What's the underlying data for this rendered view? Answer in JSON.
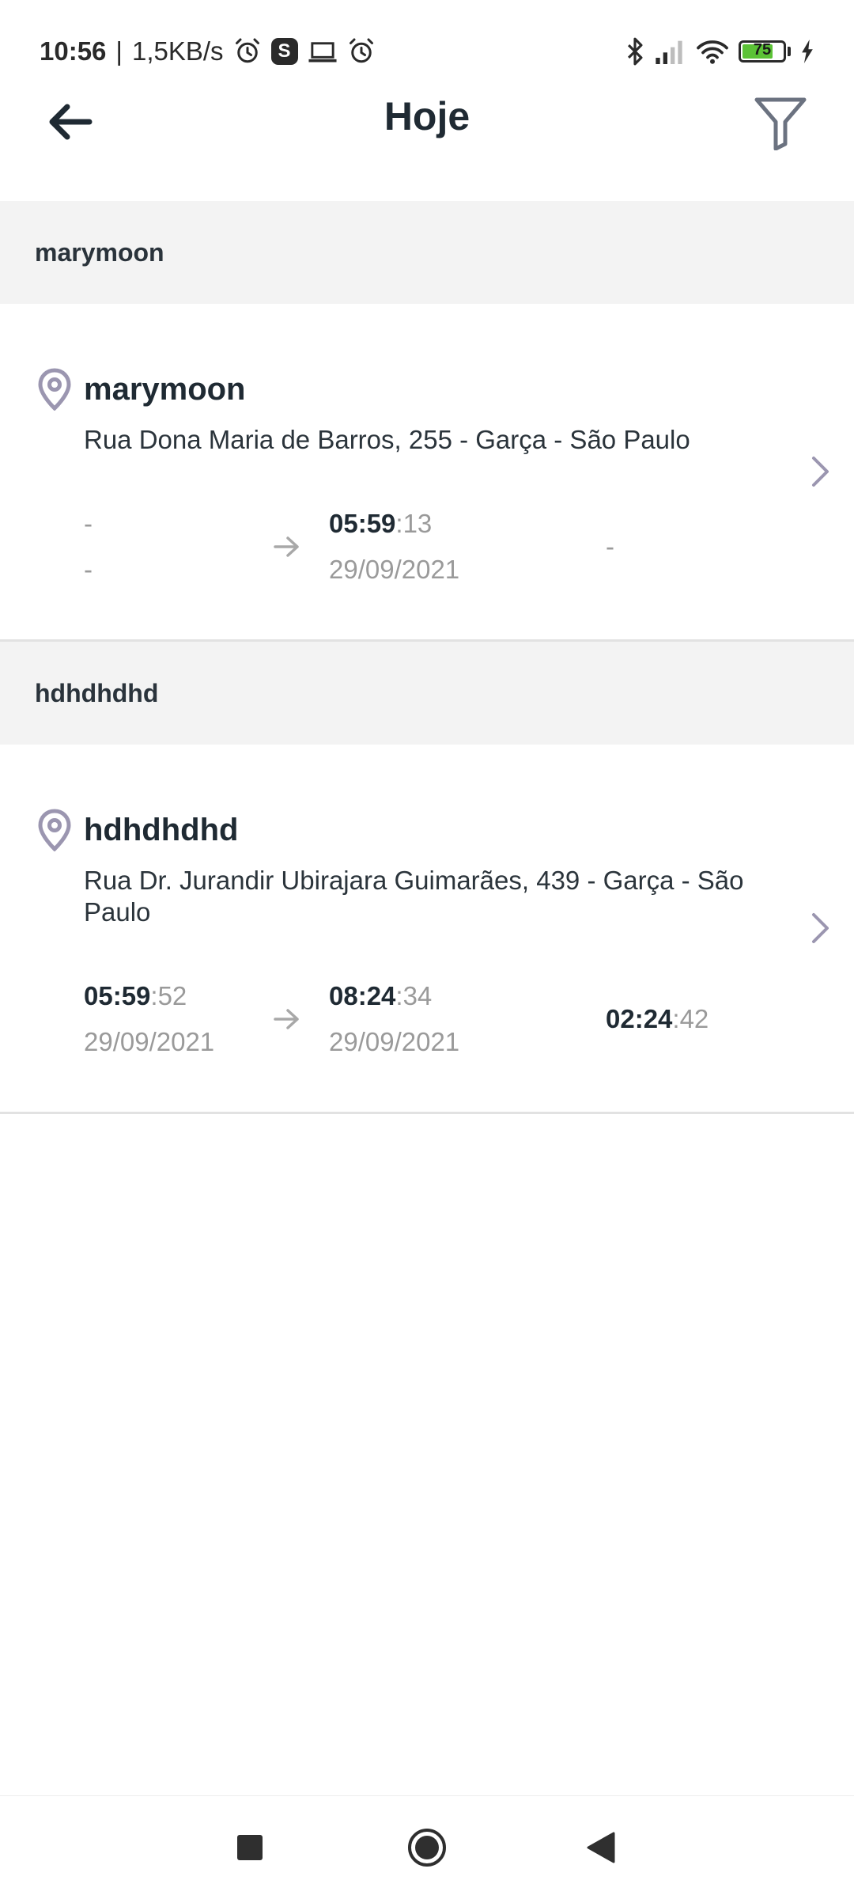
{
  "status_bar": {
    "time": "10:56",
    "separator": "|",
    "speed": "1,5KB/s",
    "battery_level": "75",
    "battery_percent": 75,
    "icons": [
      "alarm-icon",
      "skype-icon",
      "laptop-icon",
      "alarm-icon",
      "bluetooth-icon",
      "signal-icon",
      "wifi-icon",
      "battery-icon",
      "charging-icon"
    ]
  },
  "header": {
    "title": "Hoje",
    "back_icon": "arrow-left-icon",
    "filter_icon": "filter-icon"
  },
  "sections": [
    {
      "header": "marymoon",
      "card": {
        "name": "marymoon",
        "address": "Rua Dona Maria de Barros, 255 - Garça - São Paulo",
        "start_dash": "-",
        "start_date_dash": "-",
        "end_time_hm": "05:59",
        "end_time_sec": ":13",
        "end_date": "29/09/2021",
        "duration_dash": "-"
      }
    },
    {
      "header": "hdhdhdhd",
      "card": {
        "name": "hdhdhdhd",
        "address": "Rua Dr. Jurandir Ubirajara Guimarães, 439 - Garça - São Paulo",
        "start_time_hm": "05:59",
        "start_time_sec": ":52",
        "start_date": "29/09/2021",
        "end_time_hm": "08:24",
        "end_time_sec": ":34",
        "end_date": "29/09/2021",
        "duration_hm": "02:24",
        "duration_sec": ":42"
      }
    }
  ],
  "colors": {
    "accent_gray": "#9a9a9a",
    "section_bg": "#f3f3f3",
    "pin_color": "#9b96b0",
    "battery_green": "#5bc236"
  }
}
